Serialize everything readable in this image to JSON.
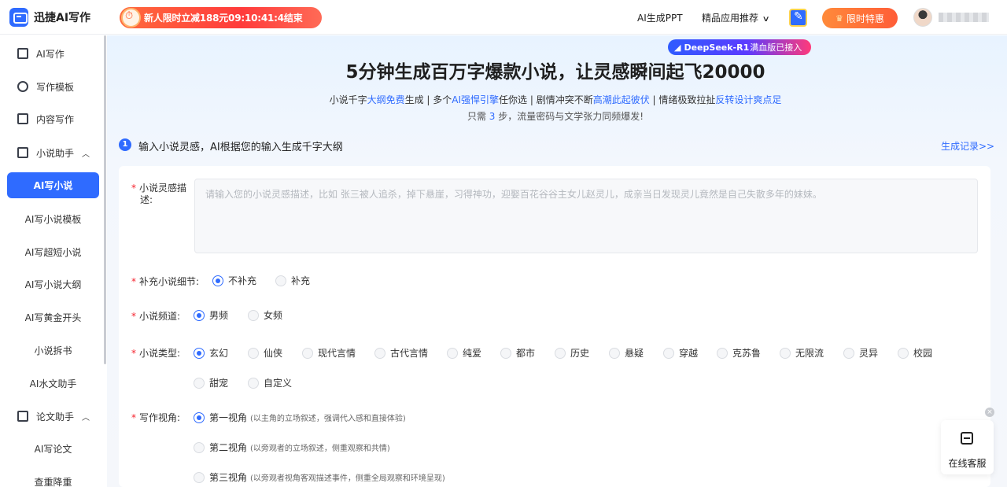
{
  "header": {
    "logo_text": "迅捷AI写作",
    "promo_text": "新人限时立减188元09:10:41:4结束",
    "nav_ppt": "AI生成PPT",
    "nav_apps": "精品应用推荐",
    "vip_label": "限时特惠"
  },
  "sidebar": {
    "groups": [
      {
        "label": "AI写作",
        "icon": "ai-write-icon"
      },
      {
        "label": "写作模板",
        "icon": "template-icon"
      },
      {
        "label": "内容写作",
        "icon": "content-icon"
      },
      {
        "label": "小说助手",
        "icon": "novel-icon",
        "caret": "^"
      },
      {
        "label": "论文助手",
        "icon": "paper-icon",
        "caret": "^"
      }
    ],
    "novel_items": [
      "AI写小说",
      "AI写小说模板",
      "AI写超短小说",
      "AI写小说大纲",
      "AI写黄金开头",
      "小说拆书",
      "AI水文助手"
    ],
    "paper_items": [
      "AI写论文",
      "查重降重"
    ],
    "active": "AI写小说"
  },
  "hero": {
    "badge_brand": "DeepSeek-R1",
    "badge_text": "满血版已接入",
    "title": "5分钟生成百万字爆款小说，让灵感瞬间起飞20000",
    "sub": {
      "p1": "小说千字",
      "h1": "大纲免费",
      "p2": "生成 | 多个",
      "h2": "AI强悍引擎",
      "p3": "任你选 | 剧情冲突不断",
      "h3": "高潮此起彼伏",
      "p4": " | 情绪极致拉扯",
      "h4": "反转设计爽点足"
    },
    "sub2": {
      "p1": "只需 ",
      "h1": "3",
      "p2": " 步，流量密码与文学张力同频爆发!"
    }
  },
  "step": {
    "num": "1",
    "text": "输入小说灵感，AI根据您的输入生成千字大纲",
    "history_link": "生成记录>>"
  },
  "form": {
    "inspiration_label_1": "小说灵感描",
    "inspiration_label_2": "述:",
    "inspiration_placeholder": "请输入您的小说灵感描述，比如 张三被人追杀，掉下悬崖，习得神功，迎娶百花谷谷主女儿赵灵儿，成亲当日发现灵儿竟然是自己失散多年的妹妹。",
    "detail_label": "补充小说细节:",
    "detail_options": [
      "不补充",
      "补充"
    ],
    "channel_label": "小说频道:",
    "channel_options": [
      "男频",
      "女频"
    ],
    "type_label": "小说类型:",
    "type_options": [
      "玄幻",
      "仙侠",
      "现代言情",
      "古代言情",
      "纯爱",
      "都市",
      "历史",
      "悬疑",
      "穿越",
      "克苏鲁",
      "无限流",
      "灵异",
      "校园",
      "甜宠",
      "自定义"
    ],
    "pov_label": "写作视角:",
    "pov_options": [
      {
        "label": "第一视角",
        "hint": "(以主角的立场叙述，强调代入感和直接体验)"
      },
      {
        "label": "第二视角",
        "hint": "(以旁观者的立场叙述，侧重观察和共情)"
      },
      {
        "label": "第三视角",
        "hint": "(以旁观者视角客观描述事件，侧重全局观察和环境呈现)"
      }
    ]
  },
  "service": {
    "close": "×",
    "label": "在线客服"
  }
}
